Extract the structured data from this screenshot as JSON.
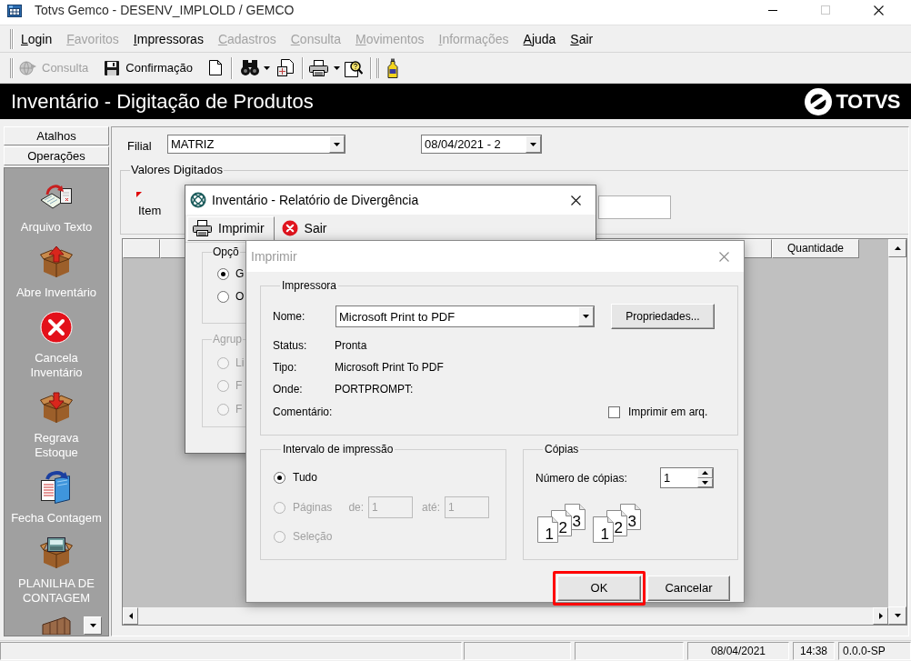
{
  "window": {
    "title": "Totvs Gemco - DESENV_IMPLOLD / GEMCO"
  },
  "menu": [
    {
      "label": "Login",
      "disabled": false
    },
    {
      "label": "Favoritos",
      "disabled": true
    },
    {
      "label": "Impressoras",
      "disabled": false
    },
    {
      "label": "Cadastros",
      "disabled": true
    },
    {
      "label": "Consulta",
      "disabled": true
    },
    {
      "label": "Movimentos",
      "disabled": true
    },
    {
      "label": "Informações",
      "disabled": true
    },
    {
      "label": "Ajuda",
      "disabled": false
    },
    {
      "label": "Sair",
      "disabled": false
    }
  ],
  "toolbar": [
    {
      "label": "Consulta",
      "disabled": true
    },
    {
      "label": "Confirmação",
      "disabled": false
    }
  ],
  "header": {
    "title": "Inventário - Digitação de Produtos",
    "logo": "TOTVS"
  },
  "sidebar": {
    "sections": [
      "Atalhos",
      "Operações"
    ],
    "items": [
      {
        "label": "Arquivo Texto"
      },
      {
        "label": "Abre Inventário"
      },
      {
        "label": "Cancela\nInventário"
      },
      {
        "label": "Regrava\nEstoque"
      },
      {
        "label": "Fecha Contagem"
      },
      {
        "label": "PLANILHA DE\nCONTAGEM"
      }
    ]
  },
  "form": {
    "filial_label": "Filial",
    "filial_value": "MATRIZ",
    "count_value": "08/04/2021 - 2",
    "group_title": "Valores Digitados",
    "item_label": "Item"
  },
  "grid": {
    "columns": [
      "Quantidade"
    ]
  },
  "report_dialog": {
    "title": "Inventário - Relatório de Divergência",
    "active": true,
    "toolbar": [
      {
        "label": "Imprimir",
        "highlighted": true
      },
      {
        "label": "Sair",
        "highlighted": false
      }
    ],
    "options_group": {
      "title": "Opçõ",
      "disabled": false,
      "options": [
        {
          "label": "G",
          "selected": true
        },
        {
          "label": "O",
          "selected": false
        }
      ]
    },
    "grouping_group": {
      "title": "Agrup",
      "disabled": true,
      "options": [
        {
          "label": "Li",
          "selected": false
        },
        {
          "label": "F",
          "selected": false
        },
        {
          "label": "F",
          "selected": false
        }
      ]
    }
  },
  "print_dialog": {
    "title": "Imprimir",
    "active": false,
    "printer_group": {
      "title": "Impressora",
      "name_label": "Nome:",
      "name_value": "Microsoft Print to PDF",
      "properties_button": "Propriedades...",
      "details": [
        {
          "label": "Status:",
          "value": "Pronta"
        },
        {
          "label": "Tipo:",
          "value": "Microsoft Print To PDF"
        },
        {
          "label": "Onde:",
          "value": "PORTPROMPT:"
        }
      ],
      "comment_label": "Comentário:",
      "print_to_file": {
        "label": "Imprimir em arq.",
        "checked": false
      }
    },
    "range_group": {
      "title": "Intervalo de impressão",
      "options": [
        {
          "label": "Tudo",
          "selected": true,
          "disabled": false
        },
        {
          "label": "Páginas",
          "selected": false,
          "disabled": true
        },
        {
          "label": "Seleção",
          "selected": false,
          "disabled": true
        }
      ],
      "from_label": "de:",
      "from_value": "1",
      "to_label": "até:",
      "to_value": "1"
    },
    "copies_group": {
      "title": "Cópias",
      "count_label": "Número de cópias:",
      "count_value": "1",
      "collate_stacks": [
        [
          "1",
          "2",
          "3"
        ],
        [
          "1",
          "2",
          "3"
        ]
      ]
    },
    "buttons": [
      {
        "label": "OK",
        "highlighted": true
      },
      {
        "label": "Cancelar",
        "highlighted": false
      }
    ]
  },
  "status_bar": {
    "panels": [
      "08/04/2021",
      "14:38",
      "0.0.0-SP"
    ]
  }
}
